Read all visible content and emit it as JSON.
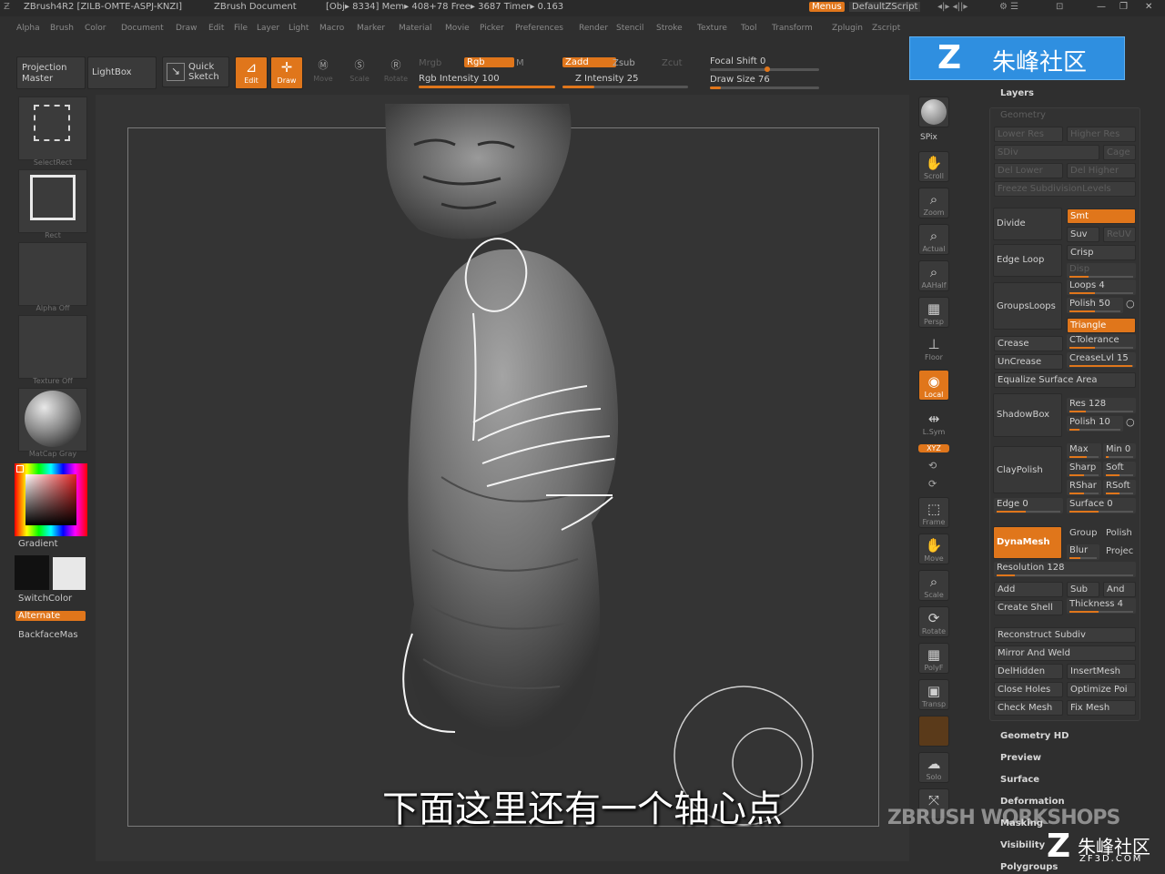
{
  "titlebar": {
    "app": "ZBrush4R2 [ZILB-OMTE-ASPJ-KNZI]",
    "doc": "ZBrush Document",
    "stats": "[Obj▸ 8334] Mem▸ 408+78 Free▸ 3687 Timer▸ 0.163",
    "menus_btn": "Menus",
    "script": "DefaultZScript"
  },
  "menubar": [
    "Alpha",
    "Brush",
    "Color",
    "Document",
    "Draw",
    "Edit",
    "File",
    "Layer",
    "Light",
    "Macro",
    "Marker",
    "Material",
    "Movie",
    "Picker",
    "Preferences",
    "Render",
    "Stencil",
    "Stroke",
    "Texture",
    "Tool",
    "Transform",
    "Zplugin",
    "Zscript"
  ],
  "toolbar": {
    "projection_master": "Projection Master",
    "lightbox": "LightBox",
    "quick_sketch": "Quick Sketch",
    "edit": "Edit",
    "draw": "Draw",
    "move": "Move",
    "scale": "Scale",
    "rotate": "Rotate",
    "mrgb": "Mrgb",
    "rgb": "Rgb",
    "m": "M",
    "rgb_intensity": "Rgb Intensity 100",
    "zadd": "Zadd",
    "zsub": "Zsub",
    "zcut": "Zcut",
    "z_intensity": "Z Intensity 25",
    "focal_shift": "Focal Shift 0",
    "draw_size": "Draw Size 76",
    "rgb_intensity_value": 100,
    "z_intensity_value": 25,
    "focal_shift_value": 0,
    "draw_size_value": 76
  },
  "logo": {
    "text": "朱峰社区"
  },
  "left_panel": {
    "select_rect": "SelectRect",
    "rect": "Rect",
    "alpha_off": "Alpha Off",
    "texture_off": "Texture Off",
    "material": "MatCap Gray",
    "gradient": "Gradient",
    "switch_color": "SwitchColor",
    "alternate": "Alternate",
    "backface": "BackfaceMas"
  },
  "right_shelf": [
    "BPR",
    "SPix",
    "Scroll",
    "Zoom",
    "Actual",
    "AAHalf",
    "Persp",
    "Floor",
    "Local",
    "L.Sym",
    "XYZ",
    "Frame",
    "Move",
    "Scale",
    "Rotate",
    "PolyF",
    "Transp",
    "Ghost",
    "Solo",
    "Xpose"
  ],
  "tool_panel": {
    "layers": "Layers",
    "geometry": "Geometry",
    "lower_res": "Lower Res",
    "higher_res": "Higher Res",
    "sdiv": "SDiv",
    "cage": "Cage",
    "del_lower": "Del Lower",
    "del_higher": "Del Higher",
    "freeze_subdiv": "Freeze SubdivisionLevels",
    "reconstruct": "Reconstruct",
    "divide": "Divide",
    "smt": "Smt",
    "suv": "Suv",
    "rel_uv": "ReUV",
    "edge_loop": "Edge Loop",
    "crisp": "Crisp",
    "disp": "Disp",
    "loops": "Loops 4",
    "groups_loops": "GroupsLoops",
    "polish": "Polish 50",
    "triangle": "Triangle",
    "crease": "Crease",
    "ctolerance": "CTolerance",
    "uncrease": "UnCrease",
    "crease_lvl": "CreaseLvl 15",
    "equalize": "Equalize Surface Area",
    "shadowbox": "ShadowBox",
    "res": "Res 128",
    "sb_polish": "Polish 10",
    "claypolish": "ClayPolish",
    "max": "Max",
    "min": "Min 0",
    "sharp": "Sharp",
    "soft": "Soft",
    "rsharp": "RShar",
    "rsoft": "RSoft",
    "edge": "Edge 0",
    "surface": "Surface 0",
    "dynamesh": "DynaMesh",
    "group": "Group",
    "dm_polish": "Polish",
    "blur": "Blur",
    "project": "Projec",
    "resolution": "Resolution 128",
    "add": "Add",
    "sub": "Sub",
    "and": "And",
    "create_shell": "Create Shell",
    "thickness": "Thickness 4",
    "reconstruct_subdiv": "Reconstruct Subdiv",
    "mirror_weld": "Mirror And Weld",
    "del_hidden": "DelHidden",
    "insert_mesh": "InsertMesh",
    "close_holes": "Close Holes",
    "optimize": "Optimize Poi",
    "check_mesh": "Check Mesh",
    "fix_mesh": "Fix Mesh",
    "sections": [
      "Geometry HD",
      "Preview",
      "Surface",
      "Deformation",
      "Masking",
      "Visibility",
      "Polygroups"
    ],
    "loops_value": 4,
    "polish_value": 50,
    "crease_lvl_value": 15,
    "res_value": 128,
    "sb_polish_value": 10,
    "resolution_value": 128,
    "thickness_value": 4
  },
  "subtitle": "下面这里还有一个轴心点",
  "watermark": {
    "workshops": "ZBRUSH WORKSHOPS",
    "brand": "朱峰社区",
    "url": "ZF3D.COM"
  },
  "colors": {
    "accent": "#e0761b",
    "logo_blue": "#2f8fe0",
    "bg": "#2f2f2f"
  }
}
